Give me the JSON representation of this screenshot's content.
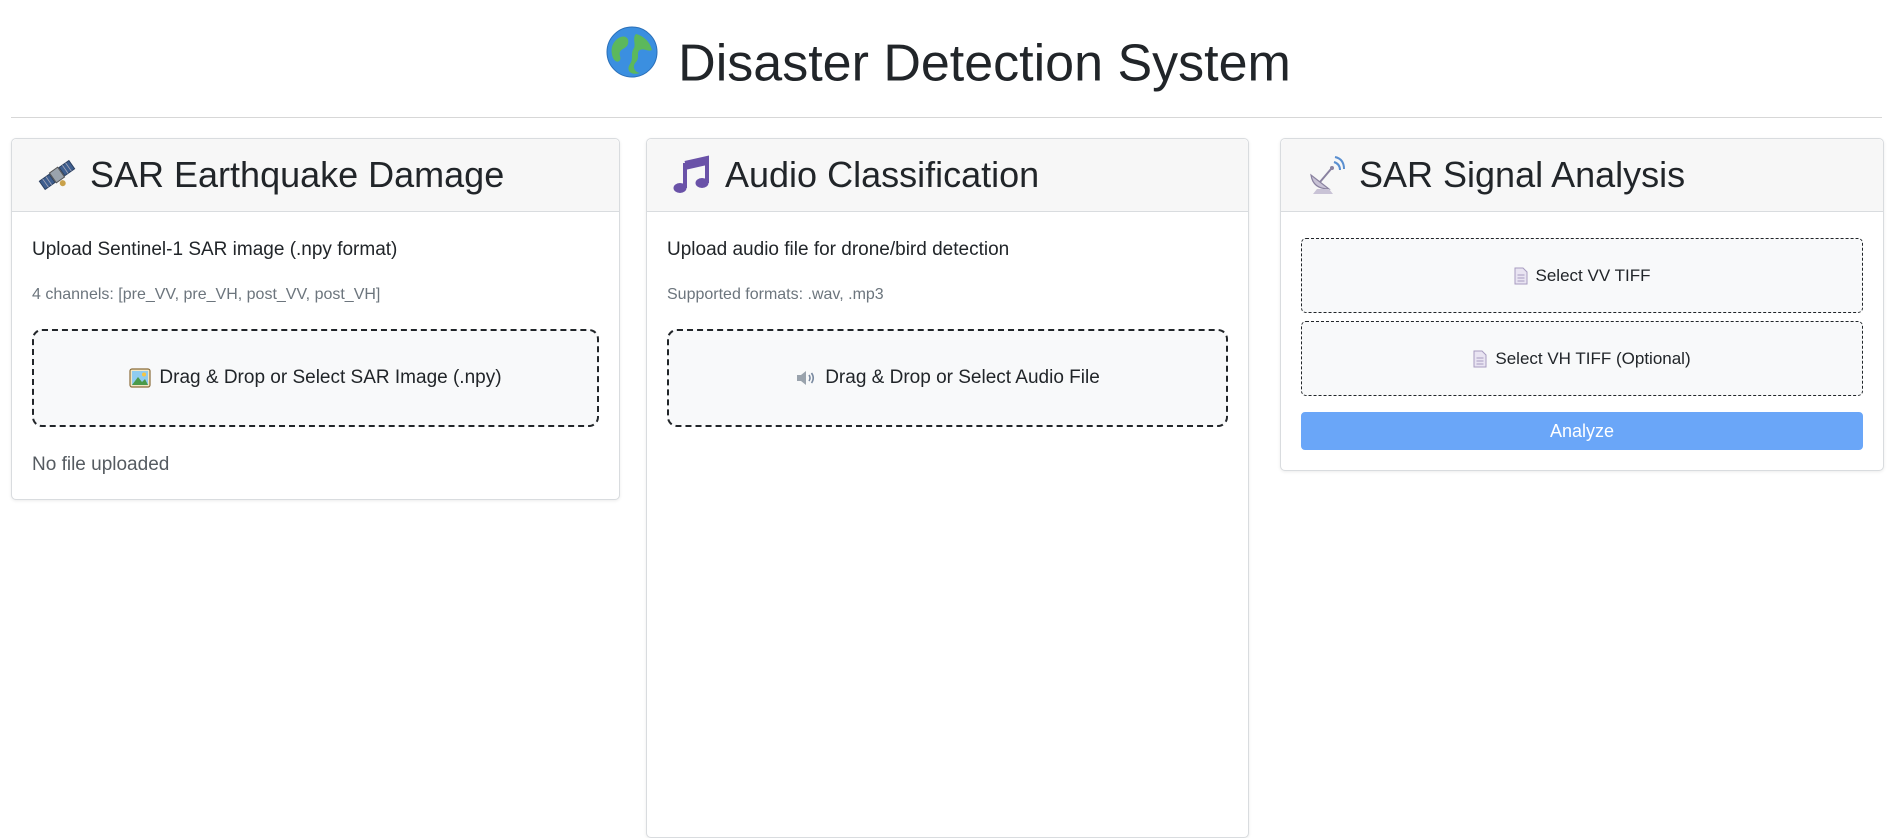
{
  "page": {
    "title": "Disaster Detection System",
    "title_icon": "globe-icon"
  },
  "cards": {
    "sar_damage": {
      "title": "SAR Earthquake Damage",
      "icon": "satellite-icon",
      "description": "Upload Sentinel-1 SAR image (.npy format)",
      "subtext": "4 channels: [pre_VV, pre_VH, post_VV, post_VH]",
      "dropzone_label": "Drag & Drop or Select SAR Image (.npy)",
      "dropzone_icon": "picture-icon",
      "status": "No file uploaded"
    },
    "audio": {
      "title": "Audio Classification",
      "icon": "music-note-icon",
      "description": "Upload audio file for drone/bird detection",
      "subtext": "Supported formats: .wav, .mp3",
      "dropzone_label": "Drag & Drop or Select Audio File",
      "dropzone_icon": "speaker-icon"
    },
    "sar_signal": {
      "title": "SAR Signal Analysis",
      "icon": "satellite-dish-icon",
      "vv_label": "Select VV TIFF",
      "vh_label": "Select VH TIFF (Optional)",
      "file_icon": "document-icon",
      "analyze_label": "Analyze"
    }
  },
  "colors": {
    "accent_button": "#6aa6f8",
    "header_bg": "#f7f7f7",
    "dropzone_bg": "#f8f9fa"
  }
}
